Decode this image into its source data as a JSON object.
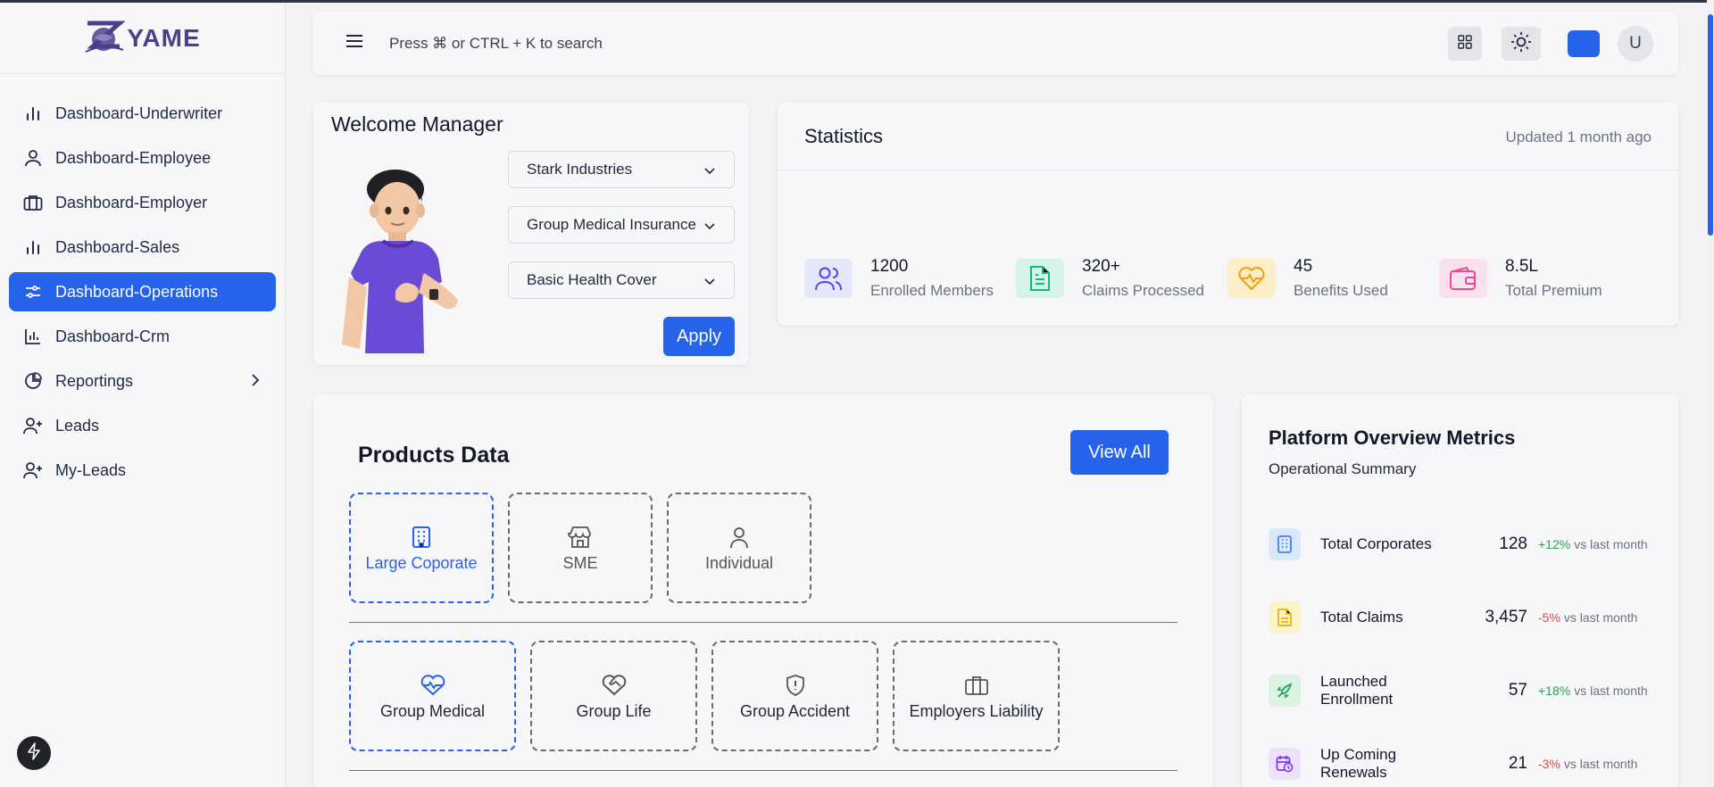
{
  "brand": {
    "name": "YAME"
  },
  "sidebar": {
    "items": [
      {
        "label": "Dashboard-Underwriter",
        "icon": "bar-chart-icon"
      },
      {
        "label": "Dashboard-Employee",
        "icon": "user-icon"
      },
      {
        "label": "Dashboard-Employer",
        "icon": "briefcase-icon"
      },
      {
        "label": "Dashboard-Sales",
        "icon": "bar-chart-icon"
      },
      {
        "label": "Dashboard-Operations",
        "icon": "sliders-icon",
        "active": true
      },
      {
        "label": "Dashboard-Crm",
        "icon": "chart-icon"
      },
      {
        "label": "Reportings",
        "icon": "pie-chart-icon",
        "has_submenu": true
      },
      {
        "label": "Leads",
        "icon": "user-plus-icon"
      },
      {
        "label": "My-Leads",
        "icon": "user-plus-icon"
      }
    ]
  },
  "topbar": {
    "search_hint": "Press ⌘ or CTRL + K to search",
    "avatar_initial": "U",
    "accent": "#2563eb"
  },
  "welcome": {
    "title": "Welcome Manager",
    "dropdowns": [
      "Stark Industries",
      "Group Medical Insurance",
      "Basic Health Cover"
    ],
    "apply_label": "Apply"
  },
  "statistics": {
    "title": "Statistics",
    "updated": "Updated 1 month ago",
    "items": [
      {
        "value": "1200",
        "label": "Enrolled Members",
        "color": "#4f46e5",
        "bg": "#e5e7fb"
      },
      {
        "value": "320+",
        "label": "Claims Processed",
        "color": "#10b981",
        "bg": "#d6f5e8"
      },
      {
        "value": "45",
        "label": "Benefits Used",
        "color": "#f59e0b",
        "bg": "#fcefc7"
      },
      {
        "value": "8.5L",
        "label": "Total Premium",
        "color": "#ec4899",
        "bg": "#fbe1ee"
      }
    ]
  },
  "products": {
    "title": "Products Data",
    "view_all": "View All",
    "segments": [
      "Large Coporate",
      "SME",
      "Individual"
    ],
    "lines": [
      "Group Medical",
      "Group Life",
      "Group Accident",
      "Employers Liability"
    ]
  },
  "platform": {
    "title": "Platform Overview Metrics",
    "subtitle": "Operational Summary",
    "vs_text": "vs last month",
    "metrics": [
      {
        "label": "Total Corporates",
        "value": "128",
        "change": "+12%",
        "trend": "up",
        "color": "#3b82f6",
        "bg": "#dbe8fb"
      },
      {
        "label": "Total Claims",
        "value": "3,457",
        "change": "-5%",
        "trend": "down",
        "color": "#eab308",
        "bg": "#fbf3c9"
      },
      {
        "label": "Launched Enrollment",
        "value": "57",
        "change": "+18%",
        "trend": "up",
        "color": "#22a355",
        "bg": "#dcf3e3"
      },
      {
        "label": "Up Coming Renewals",
        "value": "21",
        "change": "-3%",
        "trend": "down",
        "color": "#7c3aed",
        "bg": "#ece2fb"
      }
    ]
  }
}
